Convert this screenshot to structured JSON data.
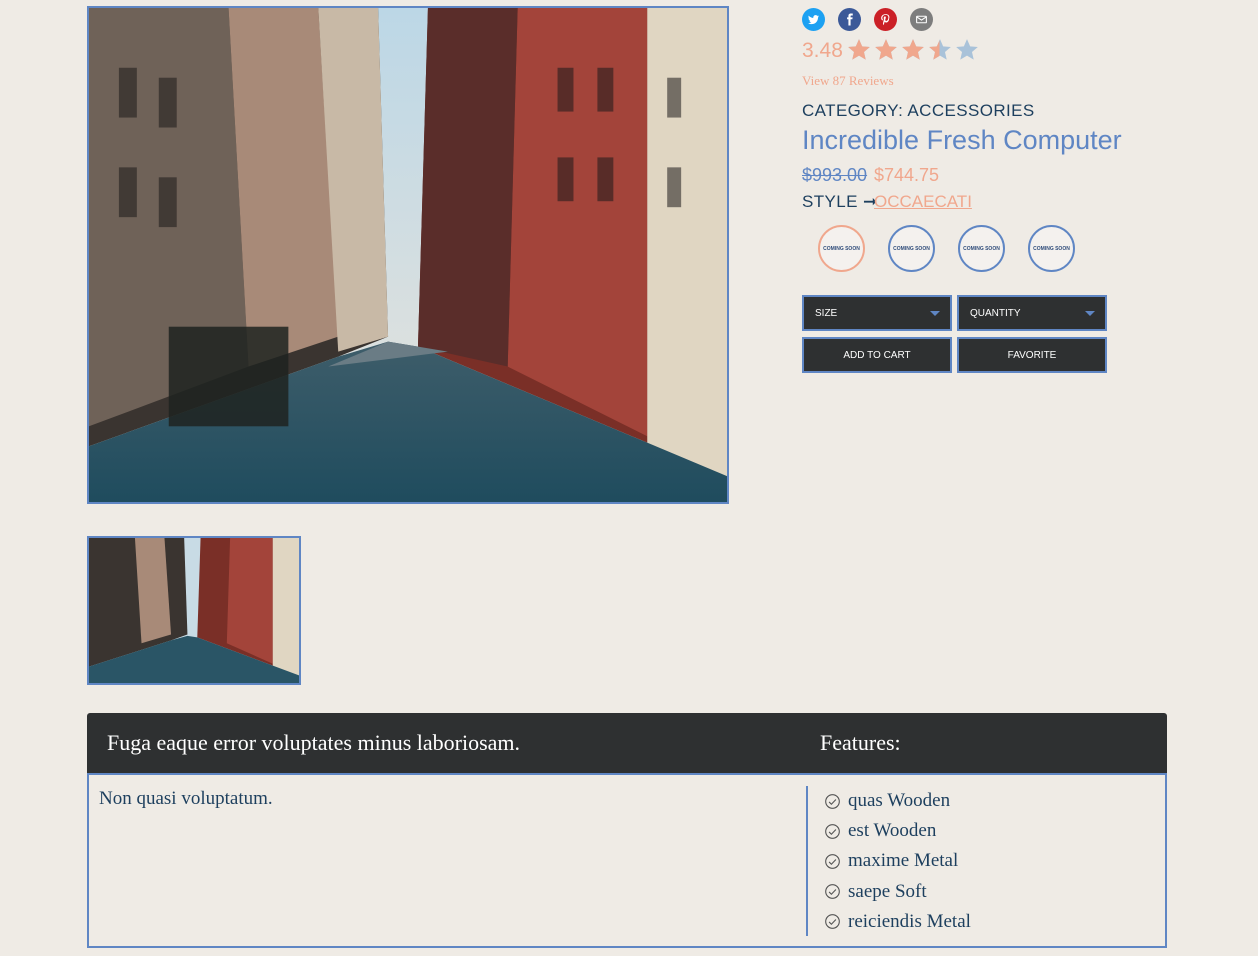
{
  "share": {
    "icons": [
      "twitter-icon",
      "facebook-icon",
      "pinterest-icon",
      "email-icon"
    ],
    "colors": {
      "twitter": "#1da1f2",
      "facebook": "#3b5998",
      "pinterest": "#cb2027",
      "email": "#7d7d7d"
    }
  },
  "rating": {
    "value": "3.48",
    "max": 5,
    "stars_filled": 3.48,
    "reviews_link": "View 87 Reviews"
  },
  "product": {
    "category": "CATEGORY: ACCESSORIES",
    "title": "Incredible Fresh Computer",
    "price_original": "$993.00",
    "price_sale": "$744.75",
    "style_label": "STYLE ➞",
    "style_value": "OCCAECATI",
    "swatch_text": "COMING SOON",
    "swatches": 4,
    "selected_swatch": 0
  },
  "controls": {
    "size_label": "SIZE",
    "quantity_label": "QUANTITY",
    "add_to_cart": "ADD TO CART",
    "favorite": "FAVORITE"
  },
  "details": {
    "title": "Fuga eaque error voluptates minus laboriosam.",
    "description": "Non quasi voluptatum.",
    "features_title": "Features:",
    "features": [
      "quas Wooden",
      "est Wooden",
      "maxime Metal",
      "saepe Soft",
      "reiciendis Metal"
    ]
  },
  "colors": {
    "background": "#efebe5",
    "accent_blue": "#5f86c4",
    "accent_peach": "#f0a78d",
    "text_navy": "#1d3f5e",
    "dark": "#2e3031"
  }
}
